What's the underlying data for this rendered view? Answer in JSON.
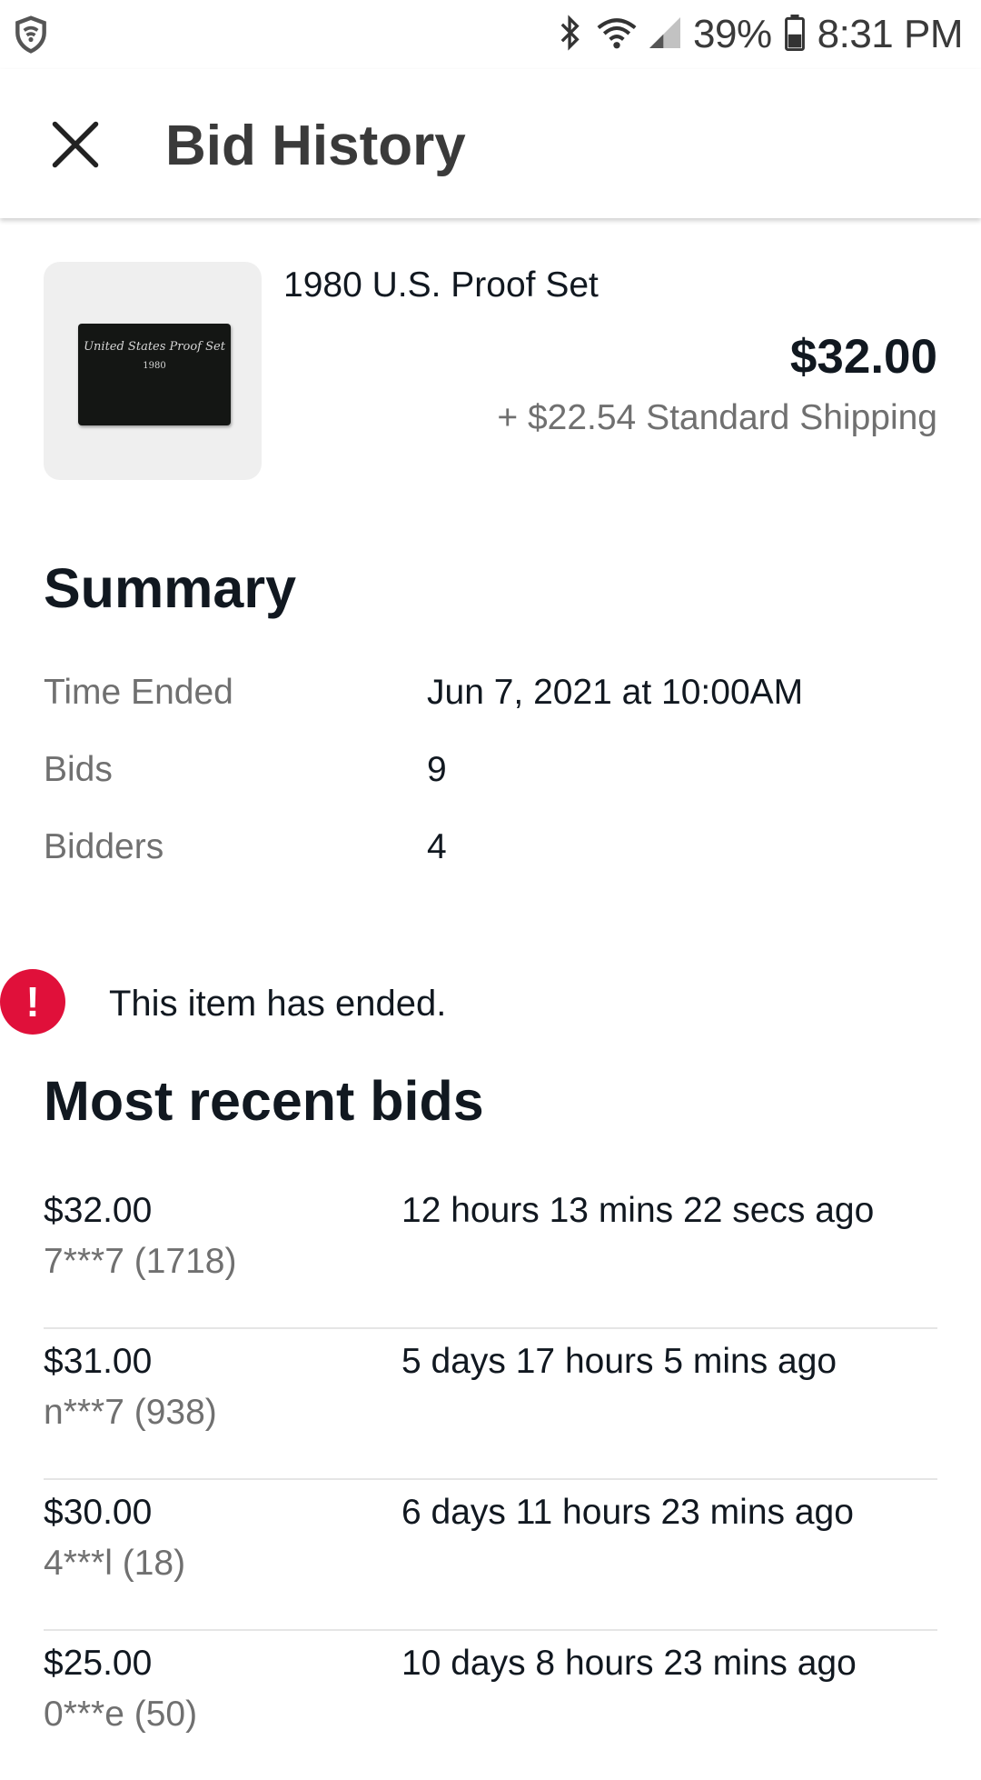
{
  "status_bar": {
    "battery": "39%",
    "time": "8:31 PM",
    "icons": [
      "shield-icon",
      "bluetooth-icon",
      "wifi-icon",
      "signal-icon",
      "battery-icon"
    ]
  },
  "header": {
    "title": "Bid History",
    "close_icon": "close-icon"
  },
  "item": {
    "title": "1980 U.S. Proof Set",
    "price": "$32.00",
    "shipping": "+ $22.54 Standard Shipping",
    "image_text_line1": "United States Proof Set",
    "image_text_line2": "1980"
  },
  "summary": {
    "title": "Summary",
    "rows": [
      {
        "label": "Time Ended",
        "value": "Jun 7, 2021 at 10:00AM"
      },
      {
        "label": "Bids",
        "value": "9"
      },
      {
        "label": "Bidders",
        "value": "4"
      }
    ]
  },
  "alert": {
    "icon_text": "!",
    "text": "This item has ended.",
    "color": "#e0103a"
  },
  "bids": {
    "title": "Most recent bids",
    "items": [
      {
        "amount": "$32.00",
        "user": "7***7 (1718)",
        "time": "12 hours 13 mins 22 secs ago"
      },
      {
        "amount": "$31.00",
        "user": "n***7 (938)",
        "time": "5 days 17 hours 5 mins ago"
      },
      {
        "amount": "$30.00",
        "user": "4***l (18)",
        "time": "6 days 11 hours 23 mins ago"
      },
      {
        "amount": "$25.00",
        "user": "0***e (50)",
        "time": "10 days 8 hours 23 mins ago"
      }
    ]
  }
}
